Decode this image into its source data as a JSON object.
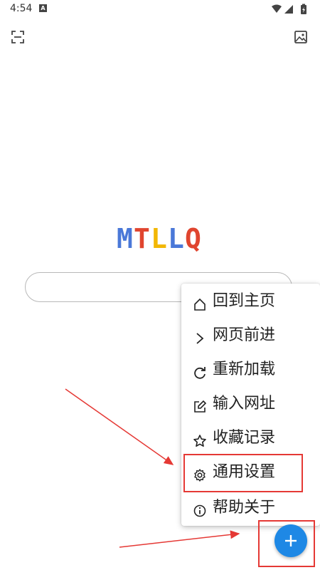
{
  "status_bar": {
    "time": "4:54",
    "notification_glyph": "A",
    "icons": [
      "wifi-icon",
      "signal-icon",
      "battery-charging-icon"
    ]
  },
  "toolbar": {
    "left_icon": "scan-icon",
    "right_icon": "image-icon"
  },
  "logo": {
    "letters": [
      {
        "char": "M",
        "color": "#4a78d8"
      },
      {
        "char": "T",
        "color": "#e0452f"
      },
      {
        "char": "L",
        "color": "#f2b705"
      },
      {
        "char": "L",
        "color": "#4a78d8"
      },
      {
        "char": "Q",
        "color": "#e0452f"
      }
    ]
  },
  "search": {
    "value": "",
    "placeholder": ""
  },
  "menu": {
    "items": [
      {
        "label": "回到主页",
        "icon": "home-icon"
      },
      {
        "label": "网页前进",
        "icon": "chevron-right-icon"
      },
      {
        "label": "重新加载",
        "icon": "reload-icon"
      },
      {
        "label": "输入网址",
        "icon": "edit-icon"
      },
      {
        "label": "收藏记录",
        "icon": "star-icon"
      },
      {
        "label": "通用设置",
        "icon": "gear-icon"
      },
      {
        "label": "帮助关于",
        "icon": "info-icon"
      }
    ]
  },
  "fab": {
    "icon": "plus-icon"
  },
  "colors": {
    "fab": "#1e88e5",
    "annotation": "#e53935"
  }
}
